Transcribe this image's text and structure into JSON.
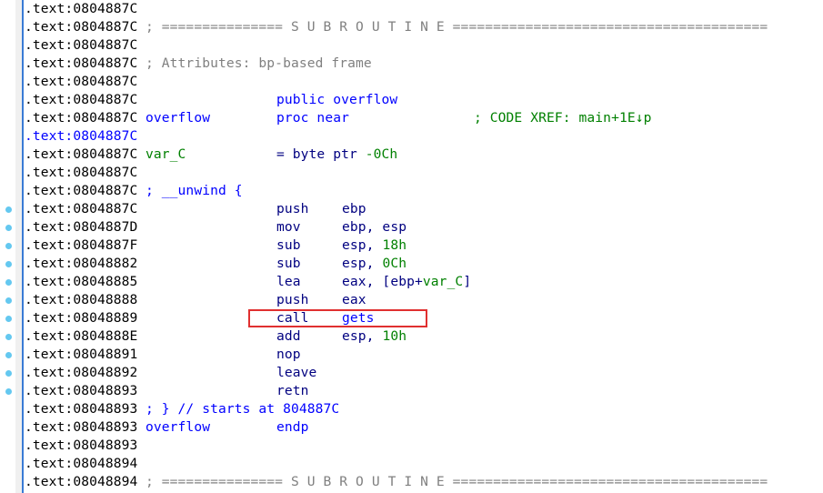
{
  "colors": {
    "address": "#000000",
    "current_address": "#0000ff",
    "comment_separator": "#808080",
    "instruction": "#000080",
    "name": "#0000ff",
    "number": "#008000",
    "xref": "#008000",
    "highlight_box": "#e03030",
    "breakpoint_dot": "#64c8f0"
  },
  "lines": [
    {
      "addr": ".text:0804887C"
    },
    {
      "addr": ".text:0804887C",
      "comment": "; =============== S U B R O U T I N E ======================================="
    },
    {
      "addr": ".text:0804887C"
    },
    {
      "addr": ".text:0804887C",
      "comment": "; Attributes: bp-based frame"
    },
    {
      "addr": ".text:0804887C"
    },
    {
      "addr": ".text:0804887C",
      "mnemonic": "public overflow"
    },
    {
      "addr": ".text:0804887C",
      "label": "overflow",
      "mnemonic": "proc near",
      "xref": "; CODE XREF: main+1E↓p"
    },
    {
      "addr": ".text:0804887C",
      "current": true
    },
    {
      "addr": ".text:0804887C",
      "label": "var_C",
      "mnemonic": "= byte ptr ",
      "num": "-0Ch"
    },
    {
      "addr": ".text:0804887C"
    },
    {
      "addr": ".text:0804887C",
      "blue_comment": "; __unwind {"
    },
    {
      "addr": ".text:0804887C",
      "mnemonic": "push",
      "operand": "ebp"
    },
    {
      "addr": ".text:0804887D",
      "mnemonic": "mov",
      "operand": "ebp, esp"
    },
    {
      "addr": ".text:0804887F",
      "mnemonic": "sub",
      "operand": "esp, ",
      "num": "18h"
    },
    {
      "addr": ".text:08048882",
      "mnemonic": "sub",
      "operand": "esp, ",
      "num": "0Ch"
    },
    {
      "addr": ".text:08048885",
      "mnemonic": "lea",
      "operand": "eax, [ebp+",
      "var": "var_C",
      "operand_tail": "]"
    },
    {
      "addr": ".text:08048888",
      "mnemonic": "push",
      "operand": "eax"
    },
    {
      "addr": ".text:08048889",
      "mnemonic": "call",
      "call_target": "gets"
    },
    {
      "addr": ".text:0804888E",
      "mnemonic": "add",
      "operand": "esp, ",
      "num": "10h"
    },
    {
      "addr": ".text:08048891",
      "mnemonic": "nop"
    },
    {
      "addr": ".text:08048892",
      "mnemonic": "leave"
    },
    {
      "addr": ".text:08048893",
      "mnemonic": "retn"
    },
    {
      "addr": ".text:08048893",
      "blue_comment": "; } // starts at 804887C"
    },
    {
      "addr": ".text:08048893",
      "label": "overflow",
      "mnemonic": "endp"
    },
    {
      "addr": ".text:08048893"
    },
    {
      "addr": ".text:08048894"
    },
    {
      "addr": ".text:08048894",
      "comment": "; =============== S U B R O U T I N E ======================================="
    }
  ],
  "breakpoint_dot_lines": [
    11,
    12,
    13,
    14,
    15,
    16,
    17,
    18,
    19,
    20,
    21
  ],
  "highlighted_line": 17
}
